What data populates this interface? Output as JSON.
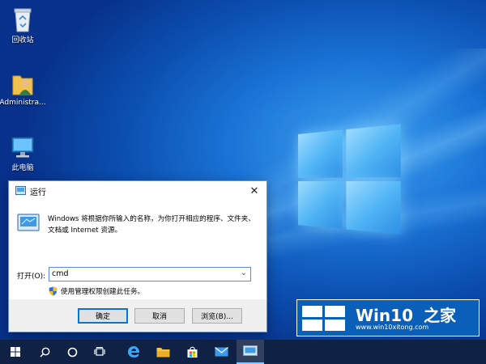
{
  "desktop": {
    "icons": [
      {
        "label": "回收站",
        "icon": "recycle-bin-icon"
      },
      {
        "label": "Administra...",
        "icon": "user-folder-icon"
      },
      {
        "label": "此电脑",
        "icon": "computer-icon"
      }
    ]
  },
  "run_dialog": {
    "title": "运行",
    "description": "Windows 将根据你所输入的名称，为你打开相应的程序、文件夹、文档或 Internet 资源。",
    "open_label": "打开(O):",
    "input_value": "cmd",
    "admin_note": "使用管理权限创建此任务。",
    "buttons": {
      "ok": "确定",
      "cancel": "取消",
      "browse": "浏览(B)..."
    }
  },
  "watermark": {
    "brand_win": "Win10",
    "brand_home": "之家",
    "url": "www.win10xitong.com"
  },
  "taskbar": {
    "items": [
      "start-icon",
      "search-icon",
      "cortana-icon",
      "task-view-icon",
      "edge-icon",
      "file-explorer-icon",
      "store-icon",
      "mail-icon",
      "run-icon"
    ]
  },
  "colors": {
    "accent": "#0078d7",
    "taskbar": "#10203e",
    "watermark_bg": "#0a5fb8"
  }
}
